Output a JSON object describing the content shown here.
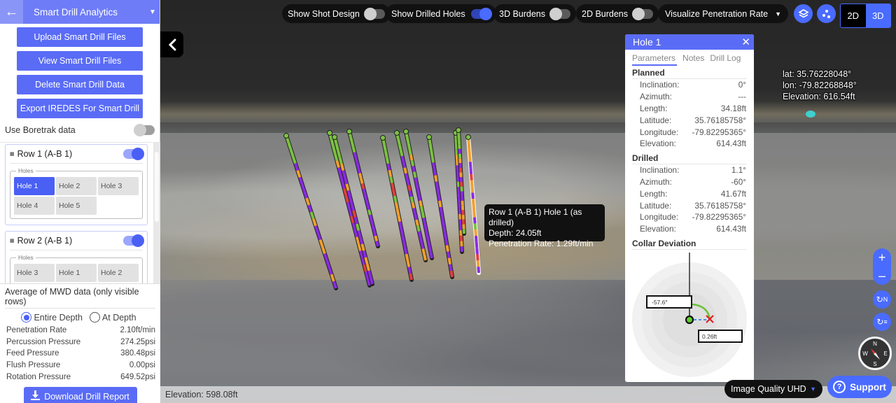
{
  "sidebar": {
    "title": "Smart Drill Analytics",
    "buttons": [
      "Upload Smart Drill Files",
      "View Smart Drill Files",
      "Delete Smart Drill Data",
      "Export IREDES For Smart Drill"
    ],
    "boretrak_label": "Use Boretrak data",
    "boretrak_on": false,
    "rows": [
      {
        "label": "Row 1 (A-B 1)",
        "visible": true,
        "holes_legend": "Holes",
        "holes": [
          "Hole 1",
          "Hole 2",
          "Hole 3",
          "Hole 4",
          "Hole 5"
        ],
        "active_hole": "Hole 1"
      },
      {
        "label": "Row 2 (A-B 1)",
        "visible": true,
        "holes_legend": "Holes",
        "holes": [
          "Hole 3",
          "Hole 1",
          "Hole 2"
        ],
        "active_hole": ""
      }
    ],
    "mwd": {
      "title": "Average of MWD data (only visible rows)",
      "options": [
        "Entire Depth",
        "At Depth"
      ],
      "selected": "Entire Depth",
      "metrics": [
        {
          "label": "Penetration Rate",
          "value": "2.10ft/min"
        },
        {
          "label": "Percussion Pressure",
          "value": "274.25psi"
        },
        {
          "label": "Feed Pressure",
          "value": "380.48psi"
        },
        {
          "label": "Flush Pressure",
          "value": "0.00psi"
        },
        {
          "label": "Rotation Pressure",
          "value": "649.52psi"
        }
      ],
      "download_label": "Download Drill Report"
    }
  },
  "toolbar": {
    "toggles": [
      {
        "label": "Show Shot Design",
        "on": false
      },
      {
        "label": "Show Drilled Holes",
        "on": true
      },
      {
        "label": "3D Burdens",
        "on": false
      },
      {
        "label": "2D Burdens",
        "on": false
      }
    ],
    "visualize_select": "Visualize Penetration Rate",
    "layers_icon": "layers-icon",
    "points_icon": "points-icon",
    "view_modes": [
      "2D",
      "3D"
    ],
    "active_view": "3D"
  },
  "hole_panel": {
    "title": "Hole 1",
    "tabs": [
      "Parameters",
      "Notes",
      "Drill Log"
    ],
    "active_tab": "Parameters",
    "planned": {
      "title": "Planned",
      "rows": [
        {
          "label": "Inclination:",
          "value": "0°"
        },
        {
          "label": "Azimuth:",
          "value": "---"
        },
        {
          "label": "Length:",
          "value": "34.18ft"
        },
        {
          "label": "Latitude:",
          "value": "35.76185758°"
        },
        {
          "label": "Longitude:",
          "value": "-79.82295365°"
        },
        {
          "label": "Elevation:",
          "value": "614.43ft"
        }
      ]
    },
    "drilled": {
      "title": "Drilled",
      "rows": [
        {
          "label": "Inclination:",
          "value": "1.1°"
        },
        {
          "label": "Azimuth:",
          "value": "-60°"
        },
        {
          "label": "Length:",
          "value": "41.67ft"
        },
        {
          "label": "Latitude:",
          "value": "35.76185758°"
        },
        {
          "label": "Longitude:",
          "value": "-79.82295365°"
        },
        {
          "label": "Elevation:",
          "value": "614.43ft"
        }
      ]
    },
    "collar_deviation": {
      "title": "Collar Deviation",
      "angle_label": "-57.6°",
      "distance_label": "0.26ft"
    }
  },
  "viewport": {
    "geo": {
      "lat": "lat: 35.76228048°",
      "lon": "lon: -79.82268848°",
      "elevation": "Elevation: 616.54ft"
    },
    "tooltip": {
      "line1": "Row 1 (A-B 1) Hole 1 (as drilled)",
      "line2": "Depth: 24.05ft",
      "line3": "Penetration Rate: 1.29ft/min"
    },
    "elevation_bar": "Elevation: 598.08ft",
    "image_quality": "Image Quality UHD",
    "support_label": "Support",
    "compass": {
      "n": "N",
      "e": "E",
      "s": "S",
      "w": "W"
    },
    "rotate_labels": [
      "N",
      "≡"
    ],
    "rate_colors": {
      "low": "#7cc242",
      "mid": "#f0a030",
      "high": "#8a2be2",
      "alert": "#e04040"
    }
  }
}
